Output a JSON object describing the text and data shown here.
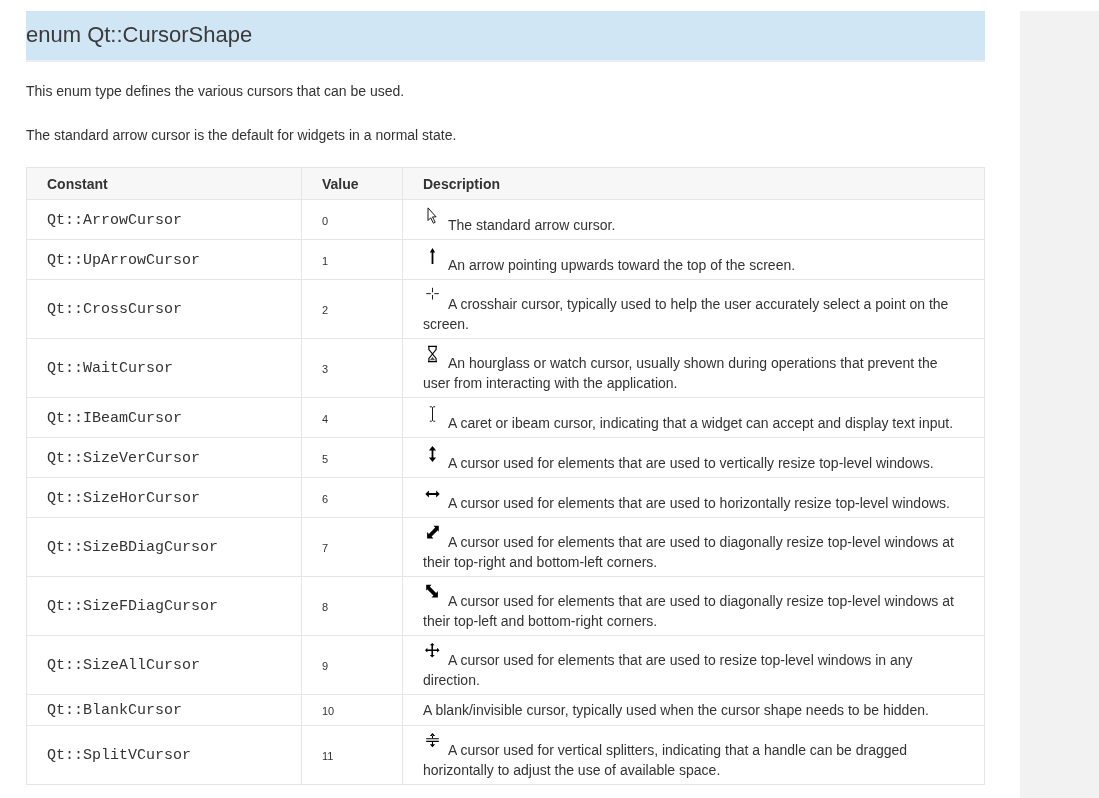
{
  "heading": "enum Qt::CursorShape",
  "paragraphs": [
    "This enum type defines the various cursors that can be used.",
    "The standard arrow cursor is the default for widgets in a normal state."
  ],
  "table": {
    "columns": [
      "Constant",
      "Value",
      "Description"
    ],
    "rows": [
      {
        "constant": "Qt::ArrowCursor",
        "value": "0",
        "kind": "arrow",
        "description": "The standard arrow cursor."
      },
      {
        "constant": "Qt::UpArrowCursor",
        "value": "1",
        "kind": "up",
        "description": "An arrow pointing upwards toward the top of the screen."
      },
      {
        "constant": "Qt::CrossCursor",
        "value": "2",
        "kind": "cross",
        "description": "A crosshair cursor, typically used to help the user accurately select a point on the screen."
      },
      {
        "constant": "Qt::WaitCursor",
        "value": "3",
        "kind": "hourglass",
        "description": "An hourglass or watch cursor, usually shown during operations that prevent the user from interacting with the application."
      },
      {
        "constant": "Qt::IBeamCursor",
        "value": "4",
        "kind": "ibeam",
        "description": "A caret or ibeam cursor, indicating that a widget can accept and display text input."
      },
      {
        "constant": "Qt::SizeVerCursor",
        "value": "5",
        "kind": "vertical",
        "description": "A cursor used for elements that are used to vertically resize top-level windows."
      },
      {
        "constant": "Qt::SizeHorCursor",
        "value": "6",
        "kind": "horizontal",
        "description": "A cursor used for elements that are used to horizontally resize top-level windows."
      },
      {
        "constant": "Qt::SizeBDiagCursor",
        "value": "7",
        "kind": "bdiag",
        "description": "A cursor used for elements that are used to diagonally resize top-level windows at their top-right and bottom-left corners."
      },
      {
        "constant": "Qt::SizeFDiagCursor",
        "value": "8",
        "kind": "fdiag",
        "description": "A cursor used for elements that are used to diagonally resize top-level windows at their top-left and bottom-right corners."
      },
      {
        "constant": "Qt::SizeAllCursor",
        "value": "9",
        "kind": "move",
        "description": "A cursor used for elements that are used to resize top-level windows in any direction."
      },
      {
        "constant": "Qt::BlankCursor",
        "value": "10",
        "kind": "blank",
        "description": "A blank/invisible cursor, typically used when the cursor shape needs to be hidden."
      },
      {
        "constant": "Qt::SplitVCursor",
        "value": "11",
        "kind": "splitv",
        "description": "A cursor used for vertical splitters, indicating that a handle can be dragged horizontally to adjust the use of available space."
      }
    ]
  }
}
